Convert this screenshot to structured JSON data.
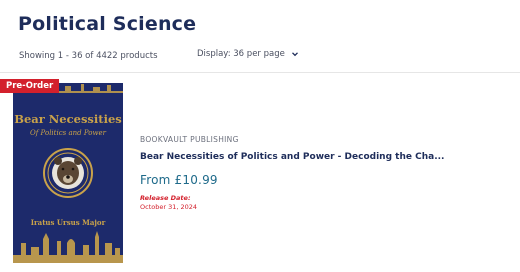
{
  "header": {
    "title": "Political Science",
    "result_count": "Showing 1 - 36 of 4422 products",
    "display_select": "Display: 36 per page"
  },
  "product": {
    "badge": "Pre-Order",
    "cover": {
      "title_line1": "Bear Necessities",
      "title_line2": "Of Politics and Power",
      "author": "Iratus Ursus Major",
      "background_color": "#1d2a6b",
      "accent_color": "#c9a24a"
    },
    "publisher": "BOOKVAULT PUBLISHING",
    "title": "Bear Necessities of Politics and Power - Decoding the Cha...",
    "price": "From £10.99",
    "release_label": "Release Date:",
    "release_date": "October 31, 2024"
  },
  "icons": {
    "display_chevron": "chevron-down-icon",
    "cover_emblem": "bear-emblem-icon"
  }
}
